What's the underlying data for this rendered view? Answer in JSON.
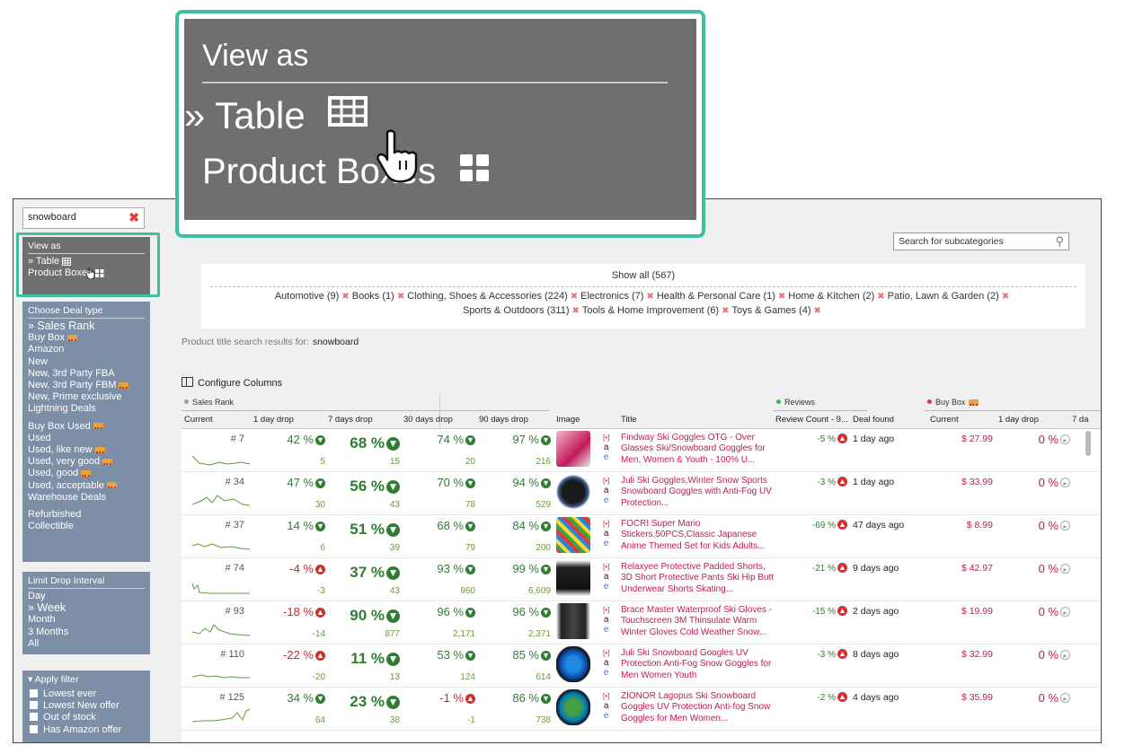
{
  "zoom": {
    "title": "View as",
    "table": "» Table",
    "product_boxes": "Product Bo​​xes"
  },
  "sidebar": {
    "search_value": "snowboard",
    "view_as": {
      "title": "View as",
      "table": "» Table",
      "product_boxes": "Product Boxes"
    },
    "deal_type": {
      "title": "Choose Deal type",
      "items": [
        {
          "label": "» Sales Rank",
          "active": true
        },
        {
          "label": "Buy Box",
          "truck": true
        },
        {
          "label": "Amazon"
        },
        {
          "label": "New"
        },
        {
          "label": "New, 3rd Party FBA"
        },
        {
          "label": "New, 3rd Party FBM",
          "truck": true
        },
        {
          "label": "New, Prime exclusive"
        },
        {
          "label": "Lightning Deals"
        },
        {
          "label": "Buy Box Used",
          "truck": true,
          "gap": true
        },
        {
          "label": "Used"
        },
        {
          "label": "Used, like new",
          "truck": true
        },
        {
          "label": "Used, very good",
          "truck": true
        },
        {
          "label": "Used, good",
          "truck": true
        },
        {
          "label": "Used, acceptable",
          "truck": true
        },
        {
          "label": "Warehouse Deals"
        },
        {
          "label": "Refurbished",
          "gap": true
        },
        {
          "label": "Collectible"
        }
      ]
    },
    "interval": {
      "title": "Limit Drop Interval",
      "items": [
        {
          "label": "Day"
        },
        {
          "label": "» Week",
          "active": true
        },
        {
          "label": "Month"
        },
        {
          "label": "3 Months"
        },
        {
          "label": "All"
        }
      ]
    },
    "filter": {
      "title": "Apply filter",
      "items": [
        "Lowest ever",
        "Lowest New offer",
        "Out of stock",
        "Has Amazon offer"
      ]
    }
  },
  "search_subcategories": {
    "placeholder": "Search for subcategories"
  },
  "categories": {
    "show_all": "Show all (567)",
    "items": [
      "Automotive (9)",
      "Books (1)",
      "Clothing, Shoes & Accessories (224)",
      "Electronics (7)",
      "Health & Personal Care (1)",
      "Home & Kitchen (2)",
      "Patio, Lawn & Garden (2)",
      "Sports & Outdoors (311)",
      "Tools & Home Improvement (6)",
      "Toys & Games (4)"
    ]
  },
  "results": {
    "label": "Product title search results for:",
    "query": "snowboard"
  },
  "configure_columns": "Configure Columns",
  "groups": {
    "sales_rank": "Sales Rank",
    "reviews": "Reviews",
    "buy_box": "Buy Box"
  },
  "columns": [
    "Current",
    "1 day drop",
    "7 days drop",
    "30 days drop",
    "90 days drop",
    "Image",
    "Title",
    "Review Count - 9...",
    "Deal found",
    "Current",
    "1 day drop",
    "7 da"
  ],
  "colors": {
    "accent": "#3fbf9f",
    "panel": "#7d8fa6",
    "green": "#2e7d32",
    "red": "#c62828",
    "pink": "#c2185b"
  },
  "rows": [
    {
      "rank": "# 7",
      "d1": "42 %",
      "d1n": "5",
      "d7": "68 %",
      "d7n": "15",
      "d30": "74 %",
      "d30n": "20",
      "d90": "97 %",
      "d90n": "216",
      "title": "Findway Ski Goggles OTG - Over Glasses Ski/Snowboard Goggles for Men, Women & Youth - 100% U...",
      "rev": "-5 %",
      "found": "1 day ago",
      "price": "$ 27.99",
      "bb": "0 %"
    },
    {
      "rank": "# 34",
      "d1": "47 %",
      "d1n": "30",
      "d7": "56 %",
      "d7n": "43",
      "d30": "70 %",
      "d30n": "78",
      "d90": "94 %",
      "d90n": "529",
      "title": "Juli Ski Goggles,Winter Snow Sports Snowboard Goggles with Anti-Fog UV Protection...",
      "rev": "-3 %",
      "found": "1 day ago",
      "price": "$ 33.99",
      "bb": "0 %"
    },
    {
      "rank": "# 37",
      "d1": "14 %",
      "d1n": "6",
      "d7": "51 %",
      "d7n": "39",
      "d30": "68 %",
      "d30n": "79",
      "d90": "84 %",
      "d90n": "200",
      "title": "FOCRI Super Mario Stickers,50PCS,Classic Japanese Anime Themed Set for Kids Adults...",
      "rev": "-69 %",
      "found": "47 days ago",
      "price": "$ 8.99",
      "bb": "0 %"
    },
    {
      "rank": "# 74",
      "d1": "-4 %",
      "d1n": "-3",
      "d7": "37 %",
      "d7n": "43",
      "d30": "93 %",
      "d30n": "960",
      "d90": "99 %",
      "d90n": "6,609",
      "title": "Relaxyee Protective Padded Shorts, 3D Short Protective Pants Ski Hip Butt Underwear Shorts Skating...",
      "rev": "-21 %",
      "found": "9 days ago",
      "price": "$ 42.97",
      "bb": "0 %"
    },
    {
      "rank": "# 93",
      "d1": "-18 %",
      "d1n": "-14",
      "d7": "90 %",
      "d7n": "877",
      "d30": "96 %",
      "d30n": "2,171",
      "d90": "96 %",
      "d90n": "2,371",
      "title": "Brace Master Waterproof Ski Gloves - Touchscreen 3M Thinsulate Warm Winter Gloves Cold Weather Snow...",
      "rev": "-15 %",
      "found": "2 days ago",
      "price": "$ 19.99",
      "bb": "0 %"
    },
    {
      "rank": "# 110",
      "d1": "-22 %",
      "d1n": "-20",
      "d7": "11 %",
      "d7n": "13",
      "d30": "53 %",
      "d30n": "124",
      "d90": "85 %",
      "d90n": "614",
      "title": "Juli Ski Snowboard Googles UV Protection Anti-Fog Snow Goggles for Men Women Youth",
      "rev": "-3 %",
      "found": "8 days ago",
      "price": "$ 32.99",
      "bb": "0 %"
    },
    {
      "rank": "# 125",
      "d1": "34 %",
      "d1n": "64",
      "d7": "23 %",
      "d7n": "38",
      "d30": "-1 %",
      "d30n": "-1",
      "d90": "86 %",
      "d90n": "738",
      "title": "ZIONOR Lagopus Ski Snowboard Goggles UV Protection Anti-fog Snow Goggles for Men Women...",
      "rev": "-2 %",
      "found": "4 days ago",
      "price": "$ 35.99",
      "bb": "0 %"
    }
  ]
}
